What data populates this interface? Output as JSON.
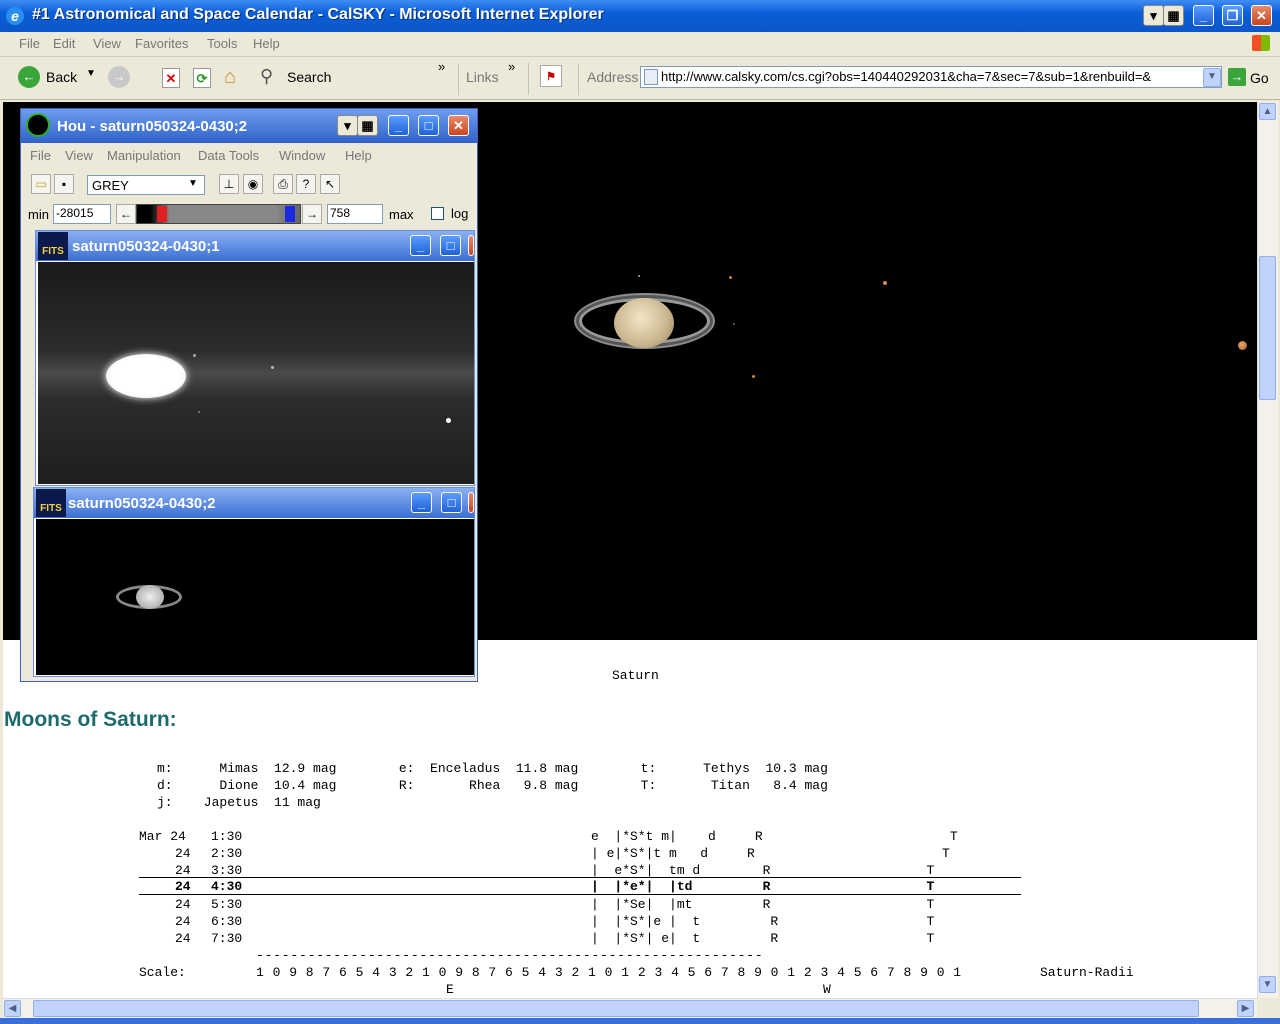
{
  "browser": {
    "title": "#1 Astronomical and Space Calendar - CalSKY - Microsoft Internet Explorer",
    "menu": [
      "File",
      "Edit",
      "View",
      "Favorites",
      "Tools",
      "Help"
    ],
    "back_label": "Back",
    "search_label": "Search",
    "links_label": "Links",
    "address_label": "Address",
    "address_url": "http://www.calsky.com/cs.cgi?obs=140440292031&cha=7&sec=7&sub=1&renbuild=&",
    "go_label": "Go",
    "icons": [
      "ie-icon",
      "back-arrow-icon",
      "forward-arrow-icon",
      "stop-icon",
      "refresh-icon",
      "home-icon",
      "search-icon",
      "pdf-icon",
      "go-arrow-icon",
      "windows-logo-icon"
    ]
  },
  "hou": {
    "title": "Hou - saturn050324-0430;2",
    "menu": [
      "File",
      "View",
      "Manipulation",
      "Data Tools",
      "Window",
      "Help"
    ],
    "colormap": "GREY",
    "min_label": "min",
    "min_value": "-28015",
    "max_value": "758",
    "max_label": "max",
    "log_label": "log",
    "sub1_title": "saturn050324-0430;1",
    "sub2_title": "saturn050324-0430;2",
    "fits_label": "FITS"
  },
  "page": {
    "caption": "Saturn",
    "heading": "Moons of Saturn:",
    "moon_legend": [
      "m:      Mimas  12.9 mag        e:  Enceladus  11.8 mag        t:      Tethys  10.3 mag",
      "d:      Dione  10.4 mag        R:       Rhea   9.8 mag        T:       Titan   8.4 mag",
      "j:    Japetus  11 mag"
    ],
    "table_rows": [
      {
        "date": "Mar 24",
        "time": "1:30",
        "diagram": "e  |*S*t m|    d     R                        T"
      },
      {
        "date": "24",
        "time": "2:30",
        "diagram": "| e|*S*|t m   d     R                        T"
      },
      {
        "date": "24",
        "time": "3:30",
        "diagram": "|  e*S*|  tm d        R                    T"
      },
      {
        "date": "24",
        "time": "4:30",
        "diagram": "|  |*e*|  |td         R                    T",
        "current": true
      },
      {
        "date": "24",
        "time": "5:30",
        "diagram": "|  |*Se|  |mt         R                    T"
      },
      {
        "date": "24",
        "time": "6:30",
        "diagram": "|  |*S*|e |  t         R                   T"
      },
      {
        "date": "24",
        "time": "7:30",
        "diagram": "|  |*S*| e|  t         R                   T"
      }
    ],
    "scale_dashes": "-----------------------------------------------------------",
    "scale_label": "Scale:",
    "scale_numbers": "1 0 9 8 7 6 5 4 3 2 1 0 9 8 7 6 5 4 3 2 1 0 1 2 3 4 5 6 7 8 9 0 1 2 3 4 5 6 7 8 9 0 1",
    "scale_unit": "Saturn-Radii",
    "east_label": "E",
    "west_label": "W"
  }
}
